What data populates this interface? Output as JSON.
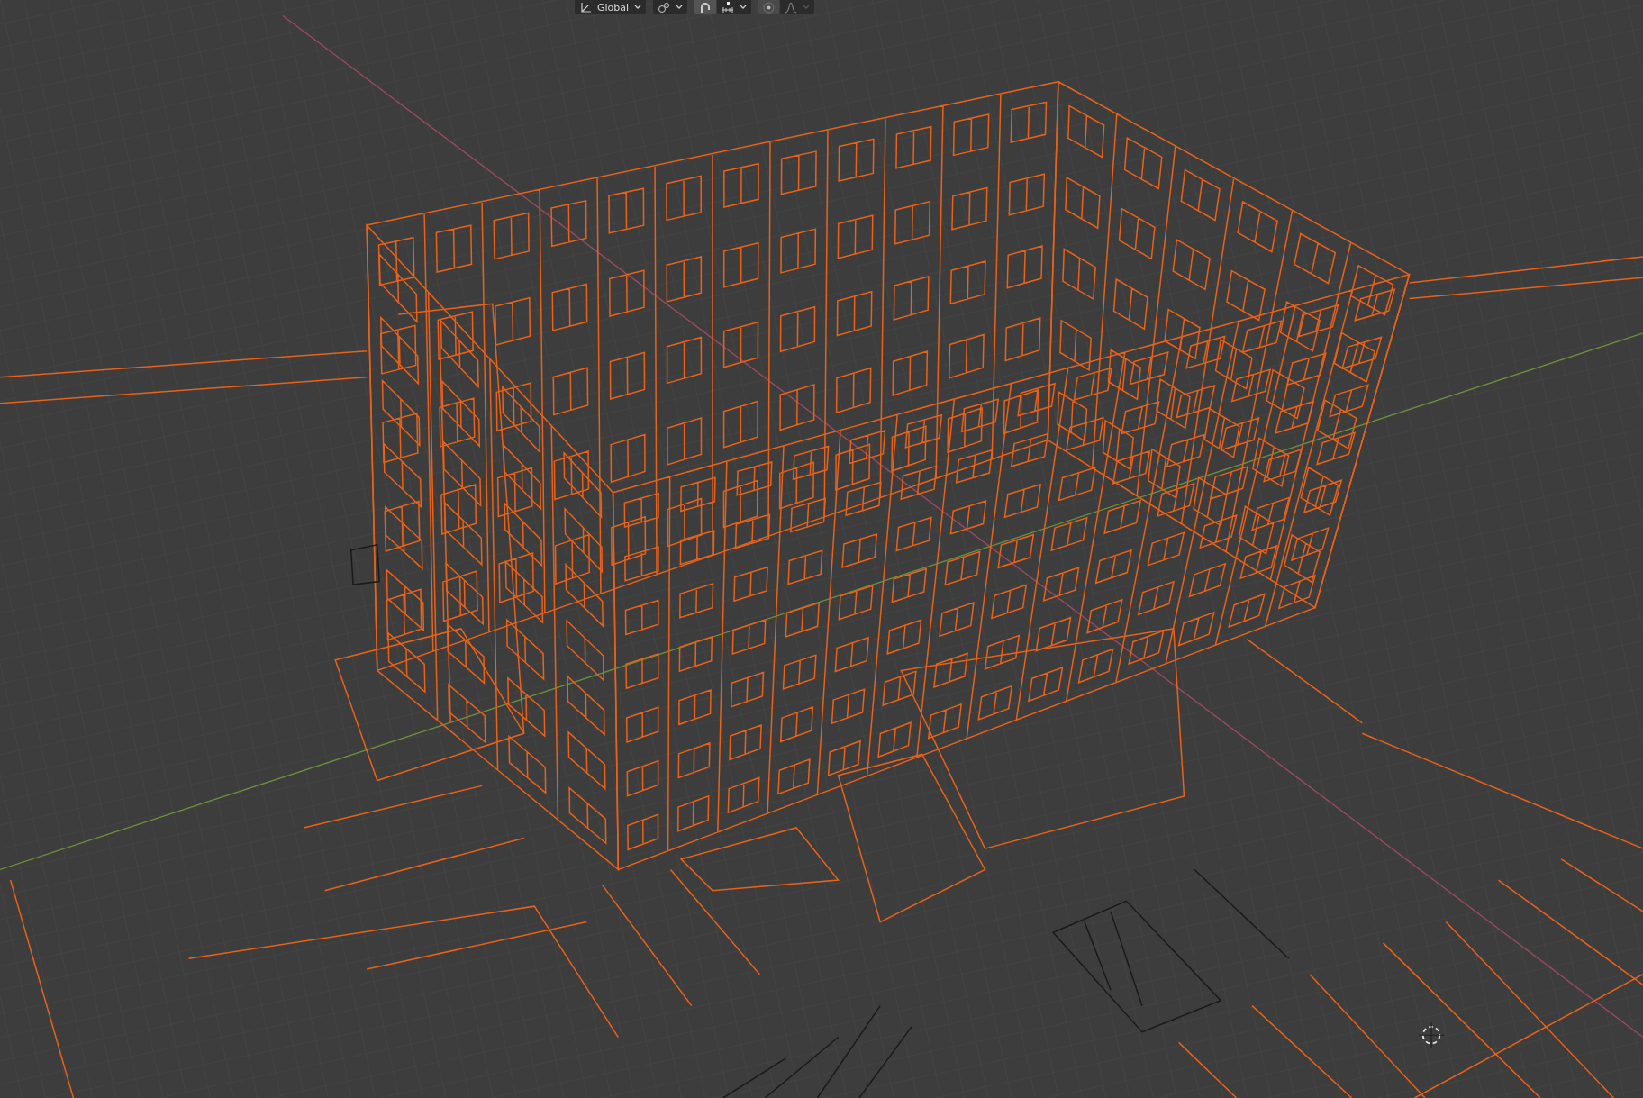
{
  "viewport": {
    "header": {
      "orientation_dropdown": {
        "label": "Global"
      },
      "snap": {
        "on": true
      },
      "proportional_editing": {
        "on": false
      }
    }
  }
}
